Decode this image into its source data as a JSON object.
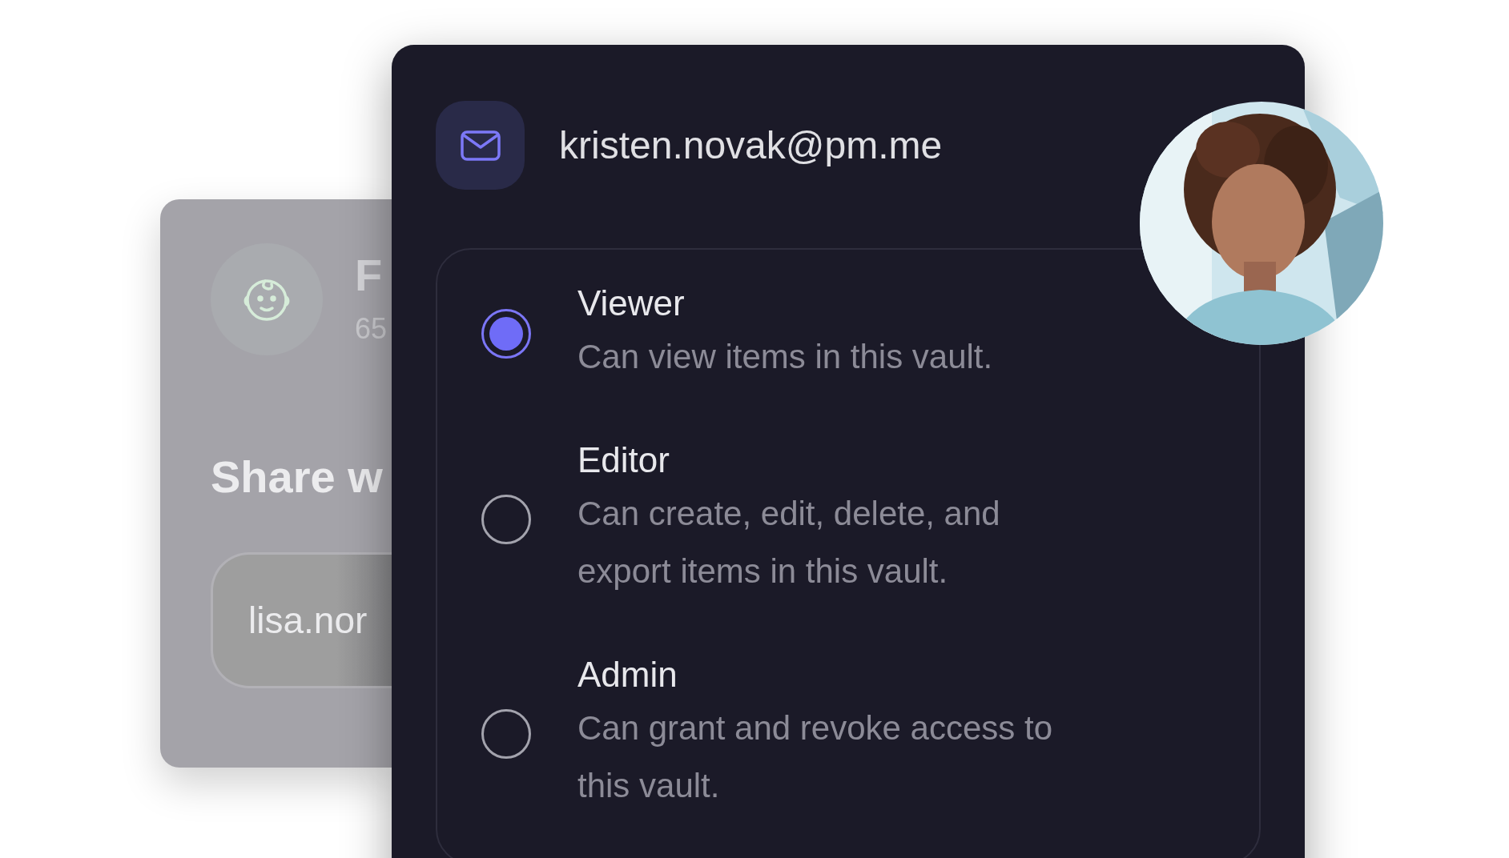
{
  "background_card": {
    "title": "F",
    "subtitle": "65",
    "heading": "Share w",
    "email_field": {
      "value": "lisa.nor"
    }
  },
  "share_card": {
    "email": "kristen.novak@pm.me",
    "roles": [
      {
        "name": "Viewer",
        "description": "Can view items in this vault.",
        "selected": true
      },
      {
        "name": "Editor",
        "description": "Can create, edit, delete, and export items in this vault.",
        "selected": false
      },
      {
        "name": "Admin",
        "description": "Can grant and revoke access to this vault.",
        "selected": false
      }
    ]
  }
}
